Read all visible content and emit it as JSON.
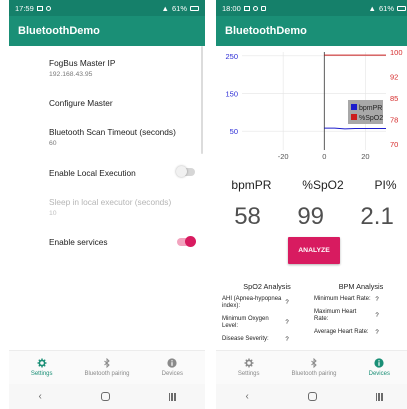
{
  "left_screen": {
    "status": {
      "time": "17:59",
      "battery": "61%"
    },
    "app_title": "BluetoothDemo",
    "settings": [
      {
        "title": "FogBus Master IP",
        "subtitle": "192.168.43.95"
      },
      {
        "title": "Configure Master",
        "subtitle": ""
      },
      {
        "title": "Bluetooth Scan Timeout (seconds)",
        "subtitle": "60"
      },
      {
        "title": "Enable Local Execution",
        "subtitle": "",
        "toggle": "off"
      },
      {
        "title": "Sleep in local executor (seconds)",
        "subtitle": "10",
        "disabled": true
      },
      {
        "title": "Enable services",
        "subtitle": "",
        "toggle": "on"
      }
    ],
    "bottom_nav": [
      {
        "label": "Settings",
        "icon": "gear-icon",
        "active": true
      },
      {
        "label": "Bluetooth pairing",
        "icon": "bluetooth-icon",
        "active": false
      },
      {
        "label": "Devices",
        "icon": "info-icon",
        "active": false
      }
    ]
  },
  "right_screen": {
    "status": {
      "time": "18:00",
      "battery": "61%"
    },
    "app_title": "BluetoothDemo",
    "metrics": {
      "labels": [
        "bpmPR",
        "%SpO2",
        "PI%"
      ],
      "values": [
        "58",
        "99",
        "2.1"
      ]
    },
    "analyze_label": "ANALYZE",
    "spo2_analysis": {
      "title": "SpO2 Analysis",
      "rows": [
        {
          "label": "AHI (Apnea-hypopnea index):",
          "value": "?"
        },
        {
          "label": "Minimum Oxygen Level:",
          "value": "?"
        },
        {
          "label": "Disease Severity:",
          "value": "?"
        }
      ]
    },
    "bpm_analysis": {
      "title": "BPM Analysis",
      "rows": [
        {
          "label": "Minimum Heart Rate:",
          "value": "?"
        },
        {
          "label": "Maximum Heart Rate:",
          "value": "?"
        },
        {
          "label": "Average Heart Rate:",
          "value": "?"
        }
      ]
    },
    "bottom_nav": [
      {
        "label": "Settings",
        "icon": "gear-icon",
        "active": false
      },
      {
        "label": "Bluetooth pairing",
        "icon": "bluetooth-icon",
        "active": false
      },
      {
        "label": "Devices",
        "icon": "info-icon",
        "active": true
      }
    ]
  },
  "chart_data": {
    "type": "line",
    "x_ticks": [
      "-20",
      "0",
      "20"
    ],
    "xlim": [
      -40,
      30
    ],
    "left_axis": {
      "ticks": [
        "250",
        "150",
        "50"
      ],
      "ylim": [
        0,
        260
      ],
      "color": "#2c2cd6"
    },
    "right_axis": {
      "ticks": [
        "100",
        "92",
        "85",
        "78",
        "70"
      ],
      "ylim": [
        68,
        100
      ],
      "color": "#d62c2c"
    },
    "series": [
      {
        "name": "bpmPR",
        "axis": "left",
        "color": "#1d1dcc",
        "points": [
          [
            0,
            58
          ],
          [
            5,
            58
          ],
          [
            10,
            56
          ],
          [
            15,
            57
          ],
          [
            20,
            57
          ],
          [
            30,
            57
          ]
        ]
      },
      {
        "name": "%SpO2",
        "axis": "right",
        "color": "#cc1d1d",
        "points": [
          [
            0,
            99
          ],
          [
            10,
            99
          ],
          [
            20,
            99
          ],
          [
            30,
            99
          ]
        ]
      }
    ]
  },
  "colors": {
    "primary": "#1a8f76",
    "status_bar": "#15806a",
    "accent": "#d81b60"
  }
}
